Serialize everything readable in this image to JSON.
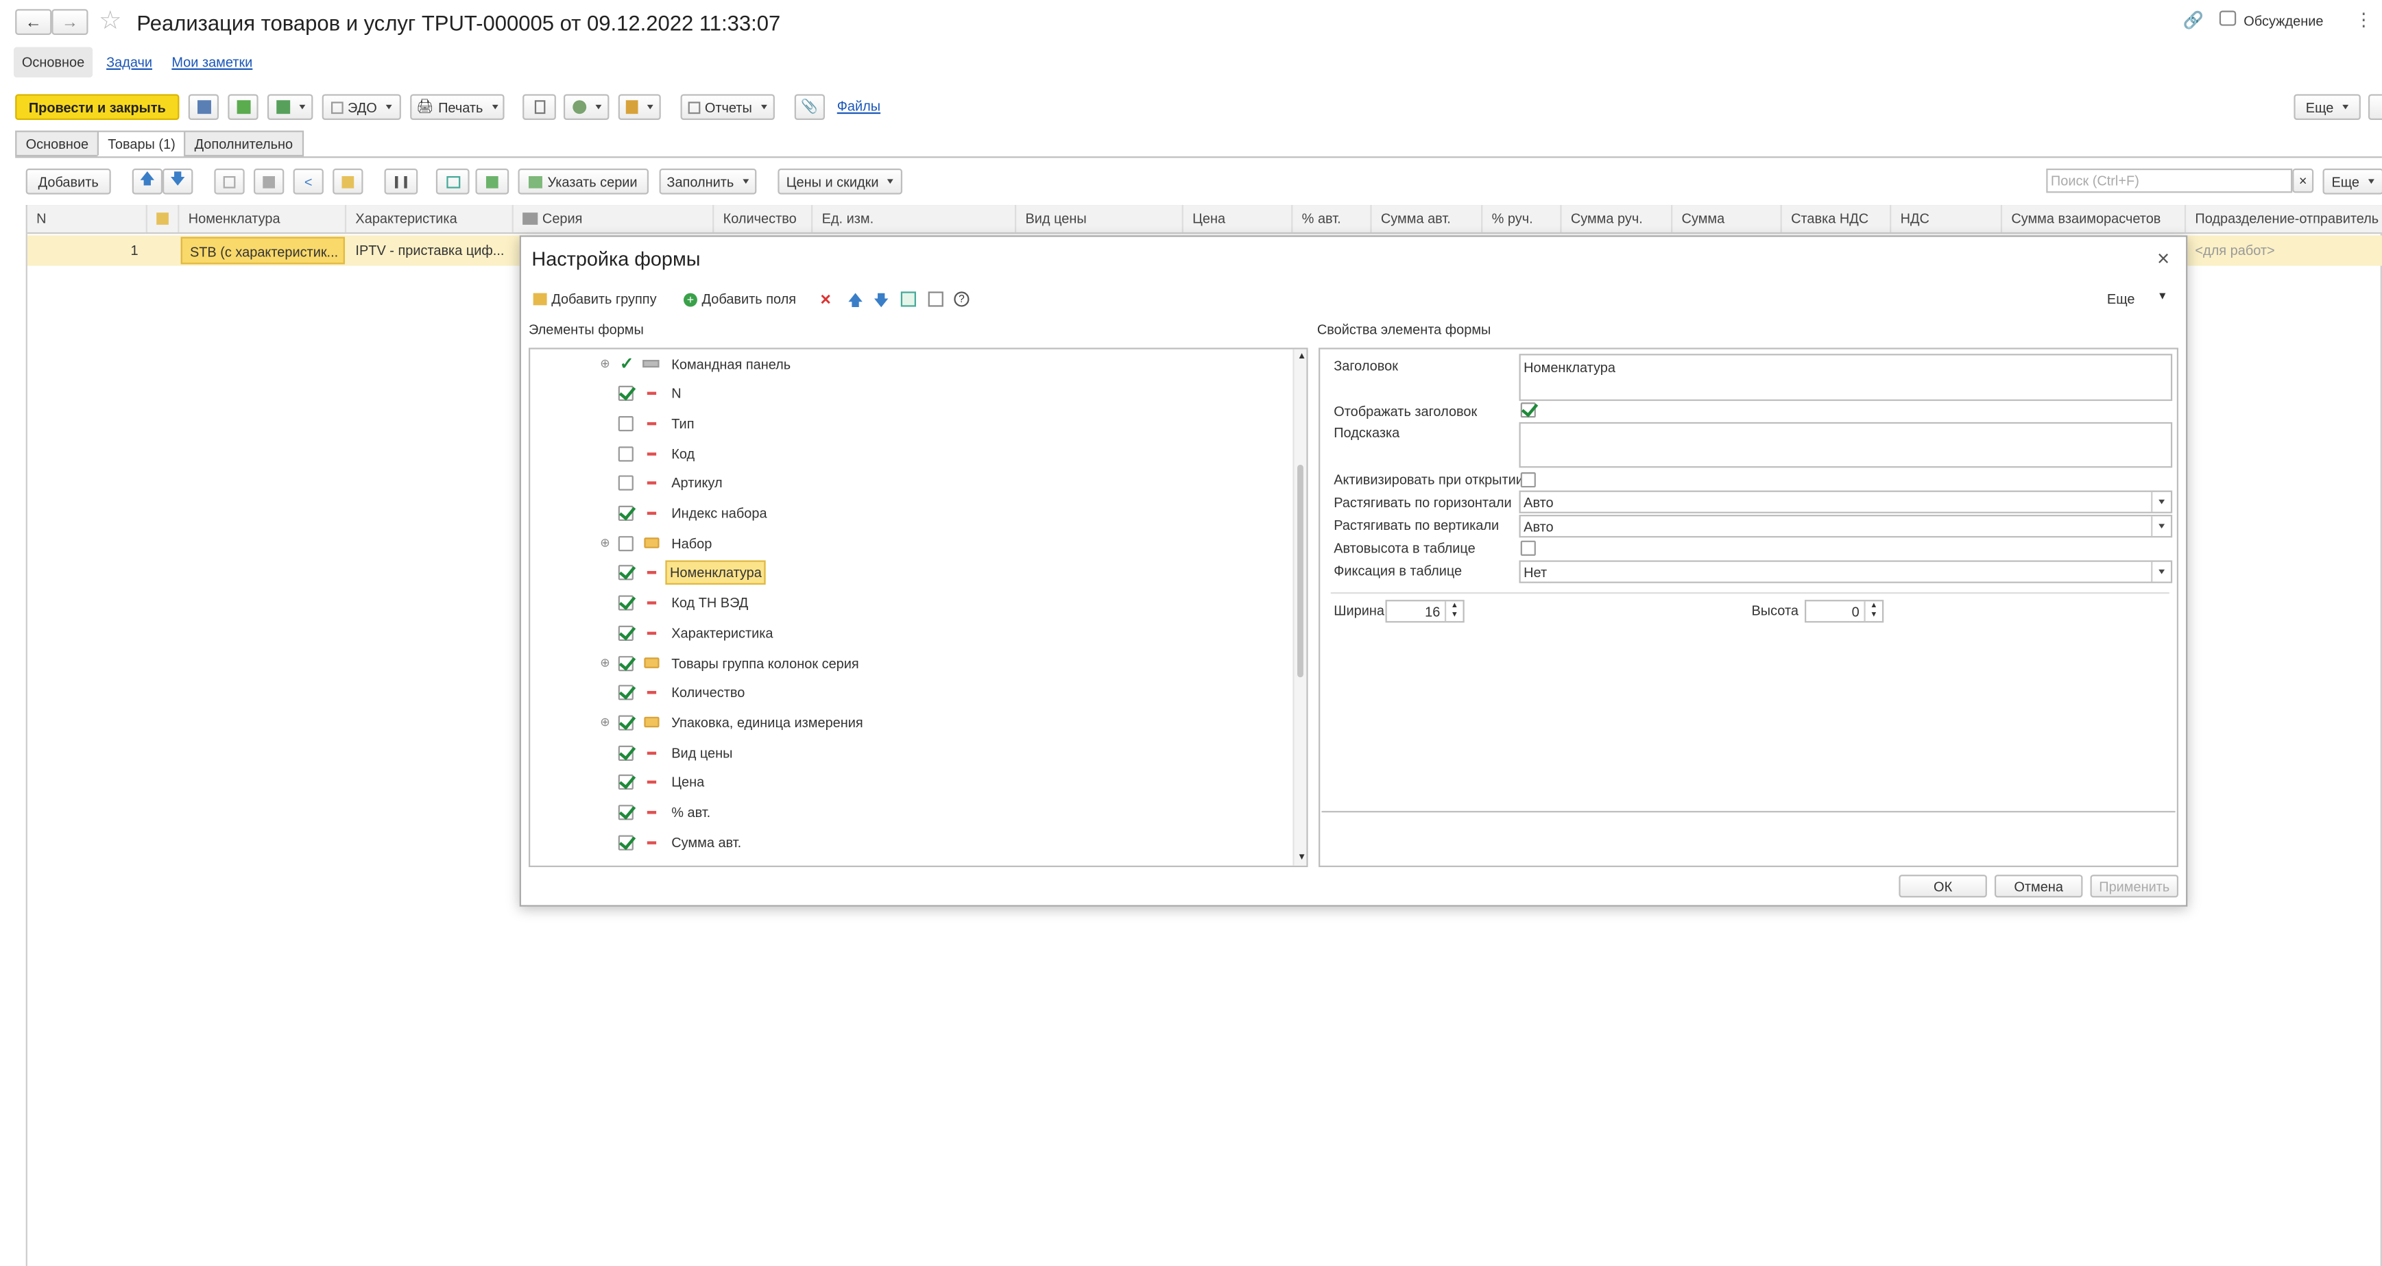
{
  "window": {
    "title": "Реализация товаров и услуг ТРUT-000005 от 09.12.2022 11:33:07",
    "discussion_label": "Обсуждение"
  },
  "top_tabs": [
    {
      "label": "Основное"
    },
    {
      "label": "Задачи"
    },
    {
      "label": "Мои заметки"
    }
  ],
  "toolbar": {
    "post_close": "Провести и закрыть",
    "edo": "ЭДО",
    "print": "Печать",
    "reports": "Отчеты",
    "files": "Файлы",
    "more": "Еще"
  },
  "doc_tabs": [
    {
      "label": "Основное"
    },
    {
      "label": "Товары (1)"
    },
    {
      "label": "Дополнительно"
    }
  ],
  "goods_toolbar": {
    "add": "Добавить",
    "series": "Указать серии",
    "fill": "Заполнить",
    "prices": "Цены и скидки",
    "search_placeholder": "Поиск (Ctrl+F)",
    "more": "Еще"
  },
  "grid": {
    "columns": [
      "N",
      "Номенклатура",
      "Характеристика",
      "Серия",
      "Количество",
      "Ед. изм.",
      "Вид цены",
      "Цена",
      "% авт.",
      "Сумма авт.",
      "% руч.",
      "Сумма руч.",
      "Сумма",
      "Ставка НДС",
      "НДС",
      "Сумма взаиморасчетов",
      "Подразделение-отправитель"
    ],
    "row": {
      "n": "1",
      "nomenclature": "STB (с характеристик...",
      "characteristic": "IPTV - приставка циф...",
      "department": "<для работ>"
    }
  },
  "dialog": {
    "title": "Настройка формы",
    "add_group": "Добавить группу",
    "add_fields": "Добавить поля",
    "more": "Еще",
    "elements_title": "Элементы формы",
    "props_title": "Свойства элемента формы",
    "tree": [
      {
        "label": "Командная панель",
        "checked": true,
        "kind": "panel",
        "expand": true
      },
      {
        "label": "N",
        "checked": true,
        "kind": "field"
      },
      {
        "label": "Тип",
        "checked": false,
        "kind": "field"
      },
      {
        "label": "Код",
        "checked": false,
        "kind": "field"
      },
      {
        "label": "Артикул",
        "checked": false,
        "kind": "field"
      },
      {
        "label": "Индекс набора",
        "checked": true,
        "kind": "field"
      },
      {
        "label": "Набор",
        "checked": false,
        "kind": "folder",
        "expand": true
      },
      {
        "label": "Номенклатура",
        "checked": true,
        "kind": "field",
        "selected": true
      },
      {
        "label": "Код ТН ВЭД",
        "checked": true,
        "kind": "field"
      },
      {
        "label": "Характеристика",
        "checked": true,
        "kind": "field"
      },
      {
        "label": "Товары группа колонок серия",
        "checked": true,
        "kind": "folder",
        "expand": true
      },
      {
        "label": "Количество",
        "checked": true,
        "kind": "field"
      },
      {
        "label": "Упаковка, единица измерения",
        "checked": true,
        "kind": "folder",
        "expand": true
      },
      {
        "label": "Вид цены",
        "checked": true,
        "kind": "field"
      },
      {
        "label": "Цена",
        "checked": true,
        "kind": "field"
      },
      {
        "label": "% авт.",
        "checked": true,
        "kind": "field"
      },
      {
        "label": "Сумма авт.",
        "checked": true,
        "kind": "field"
      }
    ],
    "props": {
      "header_label": "Заголовок",
      "header_value": "Номенклатура",
      "show_header_label": "Отображать заголовок",
      "hint_label": "Подсказка",
      "activate_label": "Активизировать при открытии",
      "stretch_h_label": "Растягивать по горизонтали",
      "stretch_h_value": "Авто",
      "stretch_v_label": "Растягивать по вертикали",
      "stretch_v_value": "Авто",
      "autoheight_label": "Автовысота в таблице",
      "fix_label": "Фиксация в таблице",
      "fix_value": "Нет",
      "width_label": "Ширина",
      "width_value": "16",
      "height_label": "Высота",
      "height_value": "0"
    },
    "ok": "ОК",
    "cancel": "Отмена",
    "apply": "Применить"
  }
}
